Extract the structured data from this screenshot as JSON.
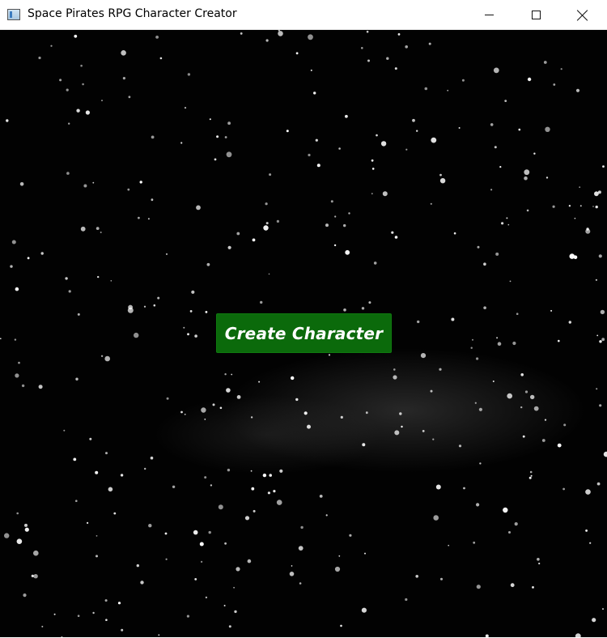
{
  "window": {
    "title": "Space Pirates RPG Character Creator",
    "icon": "app-window-icon",
    "controls": {
      "minimize_icon": "minimize-icon",
      "maximize_icon": "maximize-icon",
      "close_icon": "close-icon"
    }
  },
  "main": {
    "background": "starfield",
    "create_button_label": "Create Character",
    "button_color": "#0b6a0b"
  }
}
